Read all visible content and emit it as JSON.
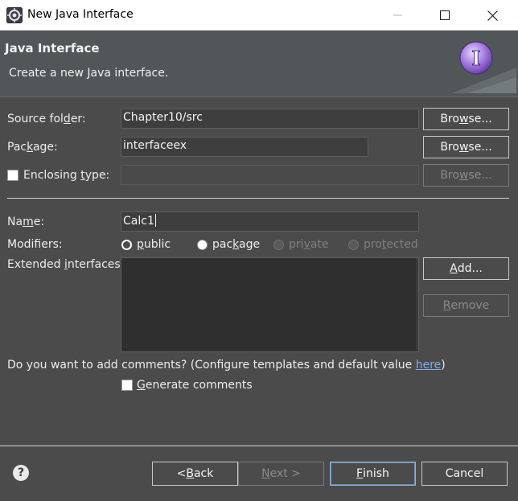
{
  "window": {
    "title": "New Java Interface",
    "controls": [
      "minimize-icon",
      "maximize-icon",
      "close-icon"
    ]
  },
  "header": {
    "title": "Java Interface",
    "description": "Create a new Java interface.",
    "graphic_letter": "I"
  },
  "form": {
    "source_folder": {
      "label_pre": "Source fol",
      "label_u": "d",
      "label_post": "er:",
      "value": "Chapter10/src",
      "browse_pre": "Bro",
      "browse_u": "w",
      "browse_post": "se..."
    },
    "package": {
      "label_pre": "Pac",
      "label_u": "k",
      "label_post": "age:",
      "value": "interfaceex",
      "browse_pre": "Bro",
      "browse_u": "w",
      "browse_post": "se..."
    },
    "enclosing_type": {
      "label_pre": "Enclosing ",
      "label_u": "t",
      "label_post": "ype:",
      "value": "",
      "checked": false,
      "browse_pre": "Bro",
      "browse_u": "w",
      "browse_post": "se..."
    },
    "name": {
      "label_pre": "Na",
      "label_u": "m",
      "label_post": "e:",
      "value": "Calc1"
    },
    "modifiers": {
      "label": "Modifiers:",
      "options": [
        {
          "pre": "",
          "u": "p",
          "post": "ublic",
          "selected": true,
          "enabled": true
        },
        {
          "pre": "pac",
          "u": "k",
          "post": "age",
          "selected": false,
          "enabled": true
        },
        {
          "pre": "pri",
          "u": "v",
          "post": "ate",
          "selected": false,
          "enabled": false
        },
        {
          "pre": "pro",
          "u": "t",
          "post": "ected",
          "selected": false,
          "enabled": false
        }
      ]
    },
    "extended_interfaces": {
      "label_pre": "Extended ",
      "label_u": "i",
      "label_post": "nterfaces:",
      "add_u": "A",
      "add_post": "dd...",
      "remove_u": "R",
      "remove_post": "emove"
    },
    "comments": {
      "question": "Do you want to add comments? (Configure templates and default value ",
      "link": "here",
      "question_end": ")",
      "generate_u": "G",
      "generate_post": "enerate comments",
      "checked": false
    }
  },
  "footer": {
    "help": "?",
    "back_pre": "< ",
    "back_u": "B",
    "back_post": "ack",
    "next_u": "N",
    "next_post": "ext >",
    "finish_u": "F",
    "finish_post": "inish",
    "cancel": "Cancel"
  },
  "colors": {
    "background": "#4b4b4b",
    "header": "#515658",
    "field": "#3e3e3e",
    "link": "#7aaef5",
    "default_button_border": "#8fb3d6"
  }
}
